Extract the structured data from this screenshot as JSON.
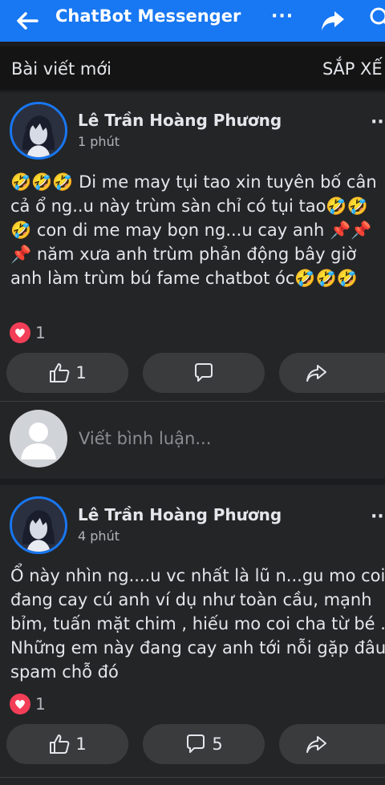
{
  "header": {
    "title": "ChatBot Messenger",
    "more_label": "···",
    "icons": [
      "back-arrow-icon",
      "share-icon",
      "search-icon"
    ]
  },
  "subheader": {
    "left_label": "Bài viết mới",
    "right_label": "SẮP XẾ"
  },
  "posts": [
    {
      "author": "Lê Trần Hoàng Phương",
      "time": "1 phút",
      "menu": "··",
      "text": "🤣🤣🤣 Di me may tụi tao xin tuyên bố cân cả ổ ng..u này trùm sàn chỉ có tụi tao🤣🤣🤣 con di me may bọn ng...u cay anh 📌📌📌 năm xưa anh trùm phản động bây giờ anh làm trùm bú fame chatbot óc🤣🤣🤣",
      "reaction_count": "1",
      "like_count": "1",
      "comment_count": "",
      "comment_placeholder": "Viết bình luận..."
    },
    {
      "author": "Lê Trần Hoàng Phương",
      "time": "4 phút",
      "menu": "··",
      "text": "Ổ này nhìn ng....u vc nhất là lũ n...gu mo coi đang cay cú anh ví dụ như toàn cầu, mạnh bỉm, tuấn mặt chim , hiếu mo coi cha từ bé . Những em này đang cay anh tới nỗi gặp đâu spam chỗ đó",
      "reaction_count": "1",
      "like_count": "1",
      "comment_count": "5"
    }
  ],
  "colors": {
    "brand_blue": "#1877f2",
    "background": "#1b1c1f",
    "card": "#242526",
    "pill": "#3a3b3c",
    "heart": "#f33e58"
  }
}
